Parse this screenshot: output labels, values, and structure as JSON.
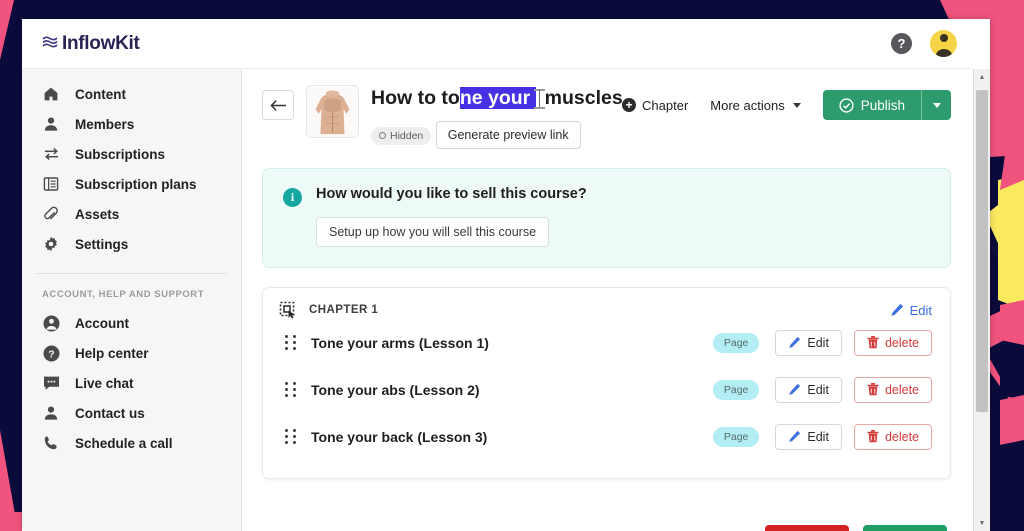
{
  "topbar": {
    "logo_wave_icon": "wave-icon",
    "logo_text": "InflowKit",
    "help_icon_label": "?",
    "avatar_icon": "avatar-icon"
  },
  "sidebar": {
    "primary_items": [
      {
        "icon": "home-icon",
        "label": "Content"
      },
      {
        "icon": "person-icon",
        "label": "Members"
      },
      {
        "icon": "exchange-icon",
        "label": "Subscriptions"
      },
      {
        "icon": "list-box-icon",
        "label": "Subscription plans"
      },
      {
        "icon": "paperclip-icon",
        "label": "Assets"
      },
      {
        "icon": "gear-icon",
        "label": "Settings"
      }
    ],
    "section_label": "ACCOUNT, HELP AND SUPPORT",
    "support_items": [
      {
        "icon": "account-circle-icon",
        "label": "Account"
      },
      {
        "icon": "question-circle-icon",
        "label": "Help center"
      },
      {
        "icon": "chat-bubble-icon",
        "label": "Live chat"
      },
      {
        "icon": "person-icon",
        "label": "Contact us"
      },
      {
        "icon": "phone-icon",
        "label": "Schedule a call"
      }
    ]
  },
  "page_header": {
    "back_icon": "arrow-left-icon",
    "thumbnail_alt": "course-thumbnail",
    "title_before": "How to to",
    "title_selected": "ne your ",
    "title_after": "muscles",
    "title_full": "How to tone your muscles",
    "hidden_badge": "Hidden",
    "preview_button": "Generate preview link",
    "chapter_button": "Chapter",
    "more_actions_button": "More actions",
    "publish_button": "Publish",
    "publish_split_icon": "chevron-down-icon"
  },
  "banner": {
    "info_icon": "info-icon",
    "question": "How would you like to sell this course?",
    "button": "Setup up how you will sell this course"
  },
  "chapter": {
    "select_icon": "selection-cursor-icon",
    "title": "CHAPTER 1",
    "edit_label": "Edit",
    "edit_icon": "pencil-icon",
    "lessons": [
      {
        "name": "Tone your arms (Lesson 1)",
        "badge": "Page",
        "edit": "Edit",
        "delete": "delete"
      },
      {
        "name": "Tone your abs (Lesson 2)",
        "badge": "Page",
        "edit": "Edit",
        "delete": "delete"
      },
      {
        "name": "Tone your back (Lesson 3)",
        "badge": "Page",
        "edit": "Edit",
        "delete": "delete"
      }
    ]
  },
  "colors": {
    "accent_green": "#2d9b6e",
    "selection_blue": "#4331e3",
    "badge_cyan": "#b2eef4",
    "delete_red": "#d33a3a",
    "link_blue": "#3d6fe0",
    "banner_teal": "#16a8a0",
    "bg_navy": "#0b0b3b",
    "bg_pink": "#f0537d",
    "bg_yellow": "#fbe960"
  }
}
